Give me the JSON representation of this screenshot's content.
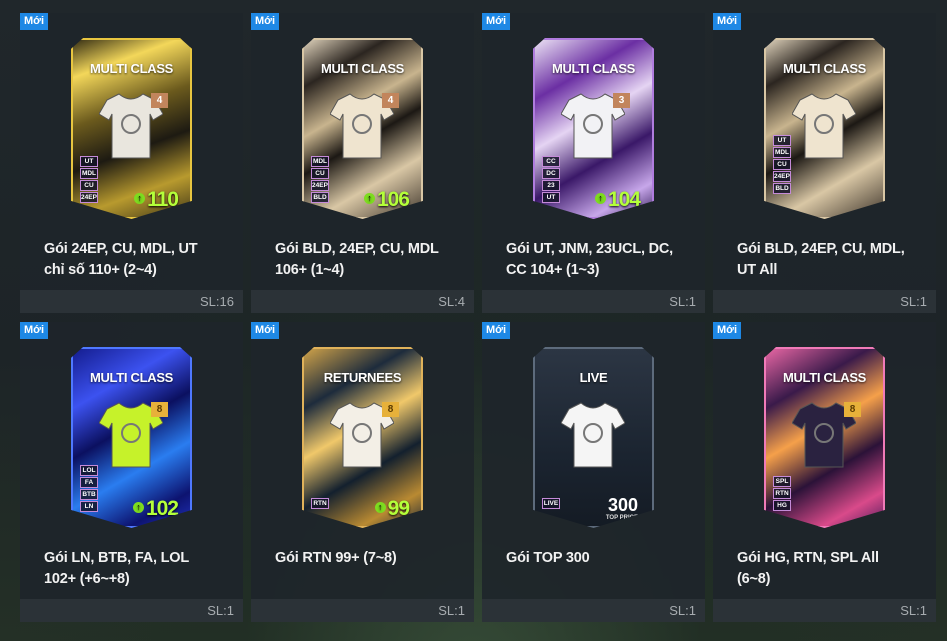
{
  "new_badge": "Mới",
  "cards": [
    {
      "title_line1": "Gói 24EP, CU, MDL, UT",
      "title_line2": "chỉ số 110+ (2~4)",
      "quantity": "SL:16",
      "card_label": "MULTI CLASS",
      "level": "4",
      "ovr": "110",
      "ovr_label": "OVR",
      "tags": [
        "UT",
        "MDL",
        "CU",
        "24EP"
      ],
      "theme": "gold",
      "shirt_color": "#e9e6de"
    },
    {
      "title_line1": "Gói BLD, 24EP, CU, MDL",
      "title_line2": "106+ (1~4)",
      "quantity": "SL:4",
      "card_label": "MULTI CLASS",
      "level": "4",
      "ovr": "106",
      "ovr_label": "OVR",
      "tags": [
        "MDL",
        "CU",
        "24EP",
        "BLD"
      ],
      "theme": "bronze",
      "shirt_color": "#efe4cf"
    },
    {
      "title_line1": "Gói UT, JNM, 23UCL, DC,",
      "title_line2": "CC 104+ (1~3)",
      "quantity": "SL:1",
      "card_label": "MULTI CLASS",
      "level": "3",
      "ovr": "104",
      "ovr_label": "OVR",
      "tags": [
        "CC",
        "DC",
        "23",
        "UT"
      ],
      "theme": "purple",
      "shirt_color": "#f2f2f5"
    },
    {
      "title_line1": "Gói BLD, 24EP, CU, MDL,",
      "title_line2": "UT All",
      "quantity": "SL:1",
      "card_label": "MULTI CLASS",
      "level": "",
      "ovr": "",
      "ovr_label": "",
      "tags": [
        "UT",
        "MDL",
        "CU",
        "24EP",
        "BLD"
      ],
      "theme": "bronze",
      "shirt_color": "#efe4cf"
    },
    {
      "title_line1": "Gói LN, BTB, FA, LOL",
      "title_line2": "102+ (+6~+8)",
      "quantity": "SL:1",
      "card_label": "MULTI CLASS",
      "level": "8",
      "ovr": "102",
      "ovr_label": "OVR",
      "tags": [
        "LOL",
        "FA",
        "BTB",
        "LN"
      ],
      "theme": "blue",
      "shirt_color": "#c6f22a"
    },
    {
      "title_line1": "Gói RTN 99+ (7~8)",
      "title_line2": "",
      "quantity": "SL:1",
      "card_label": "RETURNEES",
      "level": "8",
      "ovr": "99",
      "ovr_label": "OVR",
      "tags": [
        "RTN"
      ],
      "theme": "navygold",
      "shirt_color": "#f3efe6"
    },
    {
      "title_line1": "Gói TOP 300",
      "title_line2": "",
      "quantity": "SL:1",
      "card_label": "LIVE",
      "level": "",
      "ovr": "300",
      "ovr_label": "TOP PRICE",
      "tags": [
        "LIVE"
      ],
      "theme": "live",
      "shirt_color": "#f5f5f5"
    },
    {
      "title_line1": "Gói HG, RTN, SPL All",
      "title_line2": "(6~8)",
      "quantity": "SL:1",
      "card_label": "MULTI CLASS",
      "level": "8",
      "ovr": "",
      "ovr_label": "",
      "tags": [
        "SPL",
        "RTN",
        "HG"
      ],
      "theme": "pink",
      "shirt_color": "#2a2240"
    }
  ]
}
